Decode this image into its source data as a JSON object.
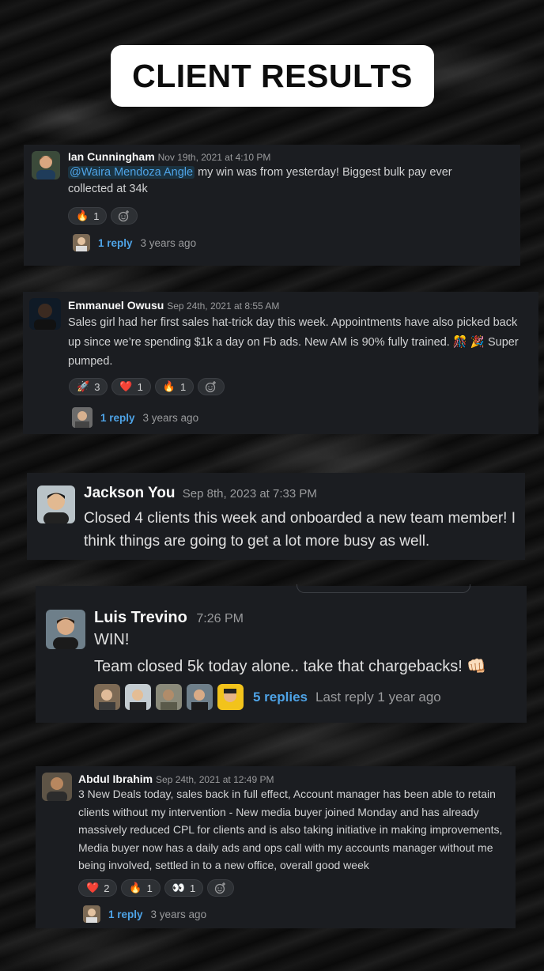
{
  "page_title": "CLIENT RESULTS",
  "messages": [
    {
      "name": "Ian Cunningham",
      "timestamp": "Nov 19th, 2021 at 4:10 PM",
      "mention": "@Waira Mendoza Angle",
      "text_after_mention": " my win was from yesterday! Biggest bulk pay ever collected at 34k",
      "reactions": [
        {
          "emoji": "🔥",
          "count": "1"
        }
      ],
      "reply_label": "1 reply",
      "reply_ago": "3 years ago"
    },
    {
      "name": "Emmanuel Owusu",
      "timestamp": "Sep 24th, 2021 at 8:55 AM",
      "text": "Sales girl had her first sales hat-trick day this week. Appointments have also picked back up since we’re spending $1k a day on Fb ads. New AM is 90% fully trained. 🎊 🎉 Super pumped.",
      "reactions": [
        {
          "emoji": "🚀",
          "count": "3"
        },
        {
          "emoji": "❤️",
          "count": "1"
        },
        {
          "emoji": "🔥",
          "count": "1"
        }
      ],
      "reply_label": "1 reply",
      "reply_ago": "3 years ago"
    },
    {
      "name": "Jackson You",
      "timestamp": "Sep 8th, 2023 at 7:33 PM",
      "text": "Closed 4 clients this week and onboarded a new team member! I think things are going to get a lot more busy as well."
    },
    {
      "name": "Luis Trevino",
      "timestamp": "7:26 PM",
      "line1": "WIN!",
      "line2": "Team closed 5k today alone.. take that chargebacks! 👊🏻",
      "reply_label": "5 replies",
      "reply_ago": "Last reply 1 year ago"
    },
    {
      "name": "Abdul Ibrahim",
      "timestamp": "Sep 24th, 2021 at 12:49 PM",
      "text": "3 New Deals today, sales back in full effect, Account manager has been able to retain clients without my intervention - New media buyer joined Monday and has already massively reduced CPL for clients and is also taking initiative in making improvements, Media buyer now has a daily ads and ops call with my accounts manager without me being involved, settled in to a new office, overall good week",
      "reactions": [
        {
          "emoji": "❤️",
          "count": "2"
        },
        {
          "emoji": "🔥",
          "count": "1"
        },
        {
          "emoji": "👀",
          "count": "1"
        }
      ],
      "reply_label": "1 reply",
      "reply_ago": "3 years ago"
    }
  ],
  "icons": {
    "add_reaction": "add-reaction-icon",
    "avatar": "avatar"
  },
  "colors": {
    "card_bg": "#1b1d21",
    "link": "#4ea3e6",
    "name": "#f8f8f8",
    "muted": "#9a9b9d"
  }
}
